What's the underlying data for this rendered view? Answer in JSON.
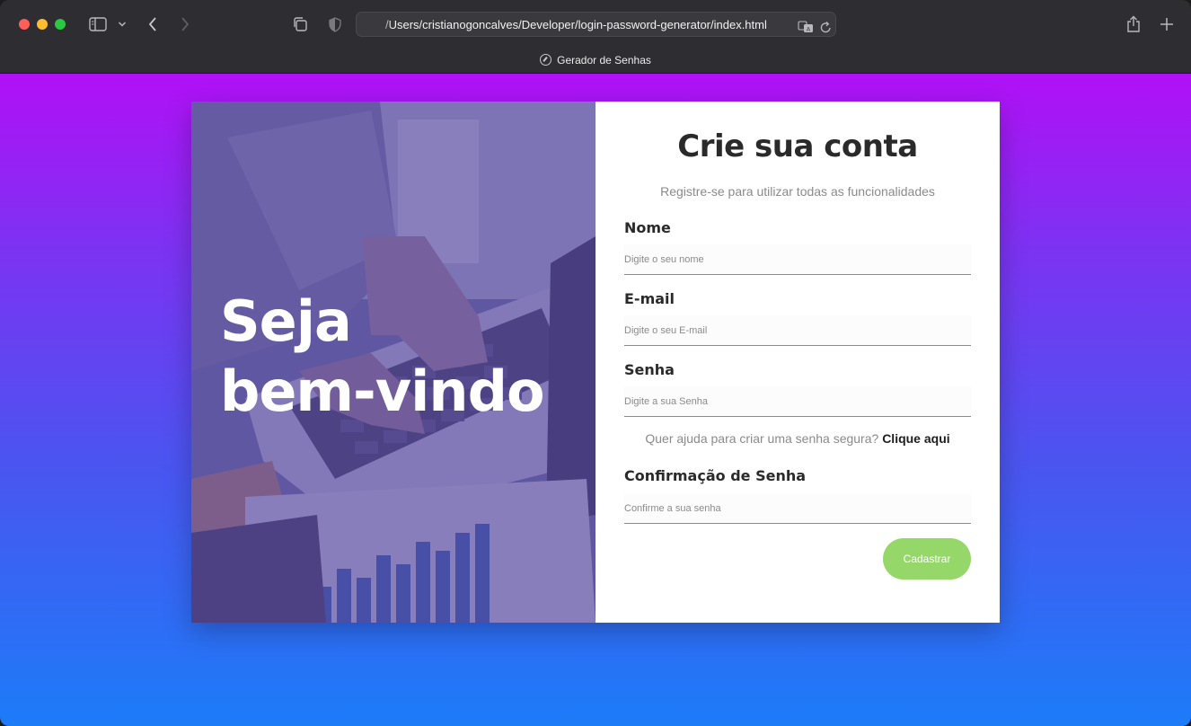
{
  "browser": {
    "url": "/Users/cristianogoncalves/Developer/login-password-generator/index.html",
    "tab_title": "Gerador de Senhas",
    "icons": [
      "sidebar-icon",
      "chevron-down-icon",
      "back-arrow-icon",
      "forward-arrow-icon",
      "tab-overview-icon",
      "privacy-shield-icon",
      "translate-icon",
      "reload-icon",
      "share-icon",
      "new-tab-icon"
    ]
  },
  "hero": {
    "line1": "Seja",
    "line2": "bem-vindo"
  },
  "form": {
    "title": "Crie sua conta",
    "subtitle": "Registre-se para utilizar todas as funcionalidades",
    "name_label": "Nome",
    "name_placeholder": "Digite o seu nome",
    "email_label": "E-mail",
    "email_placeholder": "Digite o seu E-mail",
    "password_label": "Senha",
    "password_placeholder": "Digite a sua Senha",
    "help_text": "Quer ajuda para criar uma senha segura?",
    "help_link": "Clique aqui",
    "confirm_label": "Confirmação de Senha",
    "confirm_placeholder": "Confirme a sua senha",
    "submit_label": "Cadastrar"
  },
  "colors": {
    "gradient_top": "#b110f6",
    "gradient_bottom": "#1c7cf8",
    "submit_button": "#95d768",
    "hero_overlay": "#5846a0"
  }
}
